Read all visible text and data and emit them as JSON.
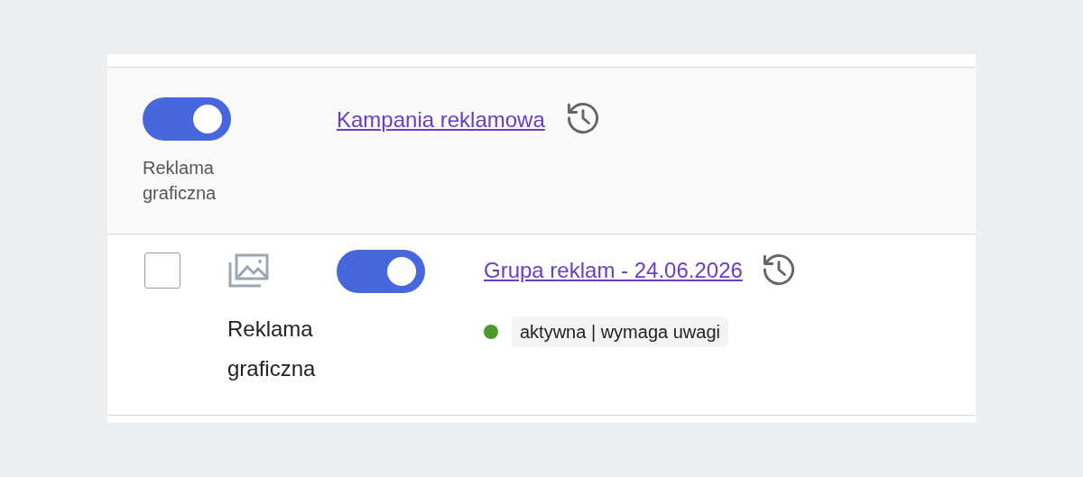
{
  "rows": [
    {
      "kind": "campaign",
      "toggle_on": true,
      "type_label": "Reklama graficzna",
      "name": "Kampania reklamowa"
    },
    {
      "kind": "ad_group",
      "checked": false,
      "toggle_on": true,
      "type_label": "Reklama graficzna",
      "name": "Grupa reklam - 24.06.2026",
      "status": {
        "color": "#4c9a2a",
        "text": "aktywna | wymaga uwagi"
      }
    }
  ]
}
